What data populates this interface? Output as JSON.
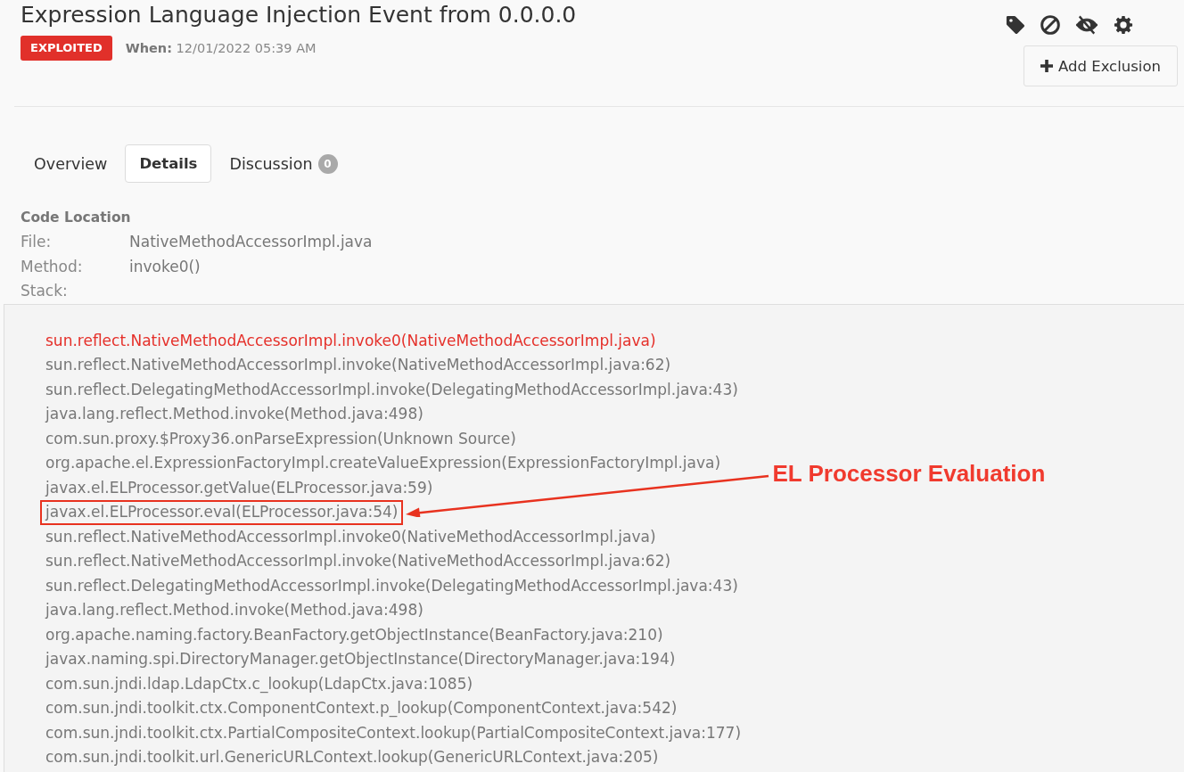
{
  "header": {
    "title": "Expression Language Injection Event from 0.0.0.0",
    "status": "EXPLOITED",
    "when": "**When:** 12/01/2022 05:39 AM",
    "action_button": "Add Exclusion"
  },
  "tabs": [
    {
      "label": "Overview",
      "selected": false
    },
    {
      "label": "Details",
      "selected": true
    },
    {
      "label": "Discussion",
      "count": "0",
      "selected": false
    }
  ],
  "code_location": {
    "heading": "Code Location",
    "fields": [
      {
        "label": "File:",
        "value": "NativeMethodAccessorImpl.java"
      },
      {
        "label": "Method:",
        "value": "invoke0()"
      },
      {
        "label": "Stack:"
      }
    ]
  },
  "stack": [
    {
      "kind": "origin",
      "text": "sun.reflect.NativeMethodAccessorImpl.invoke0(NativeMethodAccessorImpl.java)"
    },
    {
      "kind": "frame",
      "text": "sun.reflect.NativeMethodAccessorImpl.invoke(NativeMethodAccessorImpl.java:62)"
    },
    {
      "kind": "frame",
      "text": "sun.reflect.DelegatingMethodAccessorImpl.invoke(DelegatingMethodAccessorImpl.java:43)"
    },
    {
      "kind": "frame",
      "text": "java.lang.reflect.Method.invoke(Method.java:498)"
    },
    {
      "kind": "frame",
      "text": "com.sun.proxy.$Proxy36.onParseExpression(Unknown Source)"
    },
    {
      "kind": "frame",
      "text": "org.apache.el.ExpressionFactoryImpl.createValueExpression(ExpressionFactoryImpl.java)"
    },
    {
      "kind": "frame",
      "text": "javax.el.ELProcessor.getValue(ELProcessor.java:59)"
    },
    {
      "kind": "frame",
      "text": "javax.el.ELProcessor.eval(ELProcessor.java:54)",
      "annotation": "EL Processor Evaluation"
    },
    {
      "kind": "frame",
      "text": "sun.reflect.NativeMethodAccessorImpl.invoke0(NativeMethodAccessorImpl.java)"
    },
    {
      "kind": "frame",
      "text": "sun.reflect.NativeMethodAccessorImpl.invoke(NativeMethodAccessorImpl.java:62)"
    },
    {
      "kind": "frame",
      "text": "sun.reflect.DelegatingMethodAccessorImpl.invoke(DelegatingMethodAccessorImpl.java:43)"
    },
    {
      "kind": "frame",
      "text": "java.lang.reflect.Method.invoke(Method.java:498)"
    },
    {
      "kind": "frame",
      "text": "org.apache.naming.factory.BeanFactory.getObjectInstance(BeanFactory.java:210)"
    },
    {
      "kind": "frame",
      "text": "javax.naming.spi.DirectoryManager.getObjectInstance(DirectoryManager.java:194)"
    },
    {
      "kind": "frame",
      "text": "com.sun.jndi.ldap.LdapCtx.c_lookup(LdapCtx.java:1085)"
    },
    {
      "kind": "frame",
      "text": "com.sun.jndi.toolkit.ctx.ComponentContext.p_lookup(ComponentContext.java:542)"
    },
    {
      "kind": "frame",
      "text": "com.sun.jndi.toolkit.ctx.PartialCompositeContext.lookup(PartialCompositeContext.java:177)"
    },
    {
      "kind": "frame",
      "text": "com.sun.jndi.toolkit.url.GenericURLContext.lookup(GenericURLContext.java:205)"
    }
  ]
}
